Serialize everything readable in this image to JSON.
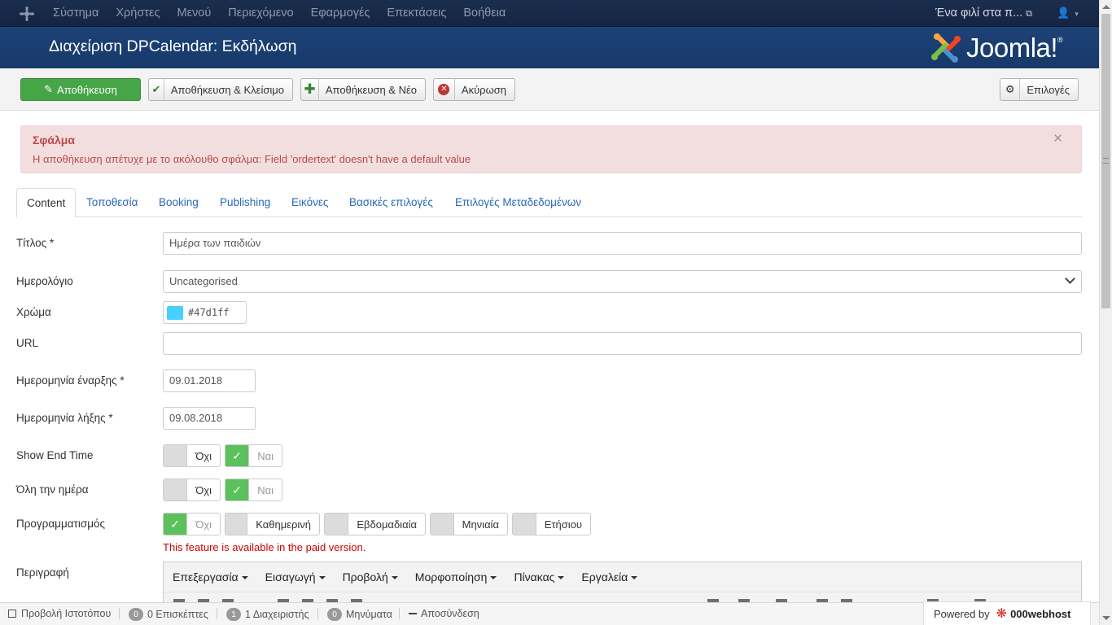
{
  "topnav": {
    "menu": [
      "Σύστημα",
      "Χρήστες",
      "Μενού",
      "Περιεχόμενο",
      "Εφαρμογές",
      "Επεκτάσεις",
      "Βοήθεια"
    ],
    "site_link": "Ένα φιλί στα π...",
    "site_link_icon": "external-link-icon",
    "user_icon": "user-icon"
  },
  "header": {
    "title": "Διαχείριση DPCalendar: Εκδήλωση",
    "brand": "Joomla!"
  },
  "toolbar": {
    "save": "Αποθήκευση",
    "save_close": "Αποθήκευση & Κλείσιμο",
    "save_new": "Αποθήκευση & Νέο",
    "cancel": "Ακύρωση",
    "options": "Επιλογές"
  },
  "alert": {
    "heading": "Σφάλμα",
    "message": "Η αποθήκευση απέτυχε με το ακόλουθο σφάλμα: Field 'ordertext' doesn't have a default value",
    "close": "×"
  },
  "tabs": [
    "Content",
    "Τοποθεσία",
    "Booking",
    "Publishing",
    "Εικόνες",
    "Βασικές επιλογές",
    "Επιλογές Μεταδεδομένων"
  ],
  "active_tab": "Content",
  "form": {
    "title_label": "Τίτλος *",
    "title_value": "Ημέρα των παιδιών",
    "calendar_label": "Ημερολόγιο",
    "calendar_value": "Uncategorised",
    "color_label": "Χρώμα",
    "color_value": "#47d1ff",
    "url_label": "URL",
    "url_value": "",
    "start_label": "Ημερομηνία έναρξης *",
    "start_value": "09.01.2018",
    "end_label": "Ημερομηνία λήξης *",
    "end_value": "09.08.2018",
    "show_end_label": "Show End Time",
    "all_day_label": "Όλη την ημέρα",
    "no": "Όχι",
    "yes": "Ναι",
    "schedule_label": "Προγραμματισμός",
    "schedule_options": [
      "Όχι",
      "Καθημερινή",
      "Εβδομαδιαία",
      "Μηνιαία",
      "Ετήσιου"
    ],
    "paid_note": "This feature is available in the paid version.",
    "description_label": "Περιγραφή",
    "check_mark": "✓"
  },
  "editor": {
    "menus": [
      "Επεξεργασία",
      "Εισαγωγή",
      "Προβολή",
      "Μορφοποίηση",
      "Πίνακας",
      "Εργαλεία"
    ]
  },
  "statusbar": {
    "view_site": "Προβολή Ιστοτόπου",
    "visitors_count": "0",
    "visitors": "0 Επισκέπτες",
    "admins_count": "1",
    "admins": "1 Διαχειριστής",
    "messages_count": "0",
    "messages": "Μηνύματα",
    "logout": "Αποσύνδεση"
  },
  "powered": {
    "label": "Powered by",
    "brand": "000webhost"
  },
  "colors": {
    "nav_bg": "#1c2e4f",
    "header_bg": "#1d4276",
    "save_green": "#46a546",
    "alert_bg": "#f2dede",
    "alert_text": "#b94a48",
    "toggle_on": "#5cc15c",
    "link": "#2a69b8"
  }
}
